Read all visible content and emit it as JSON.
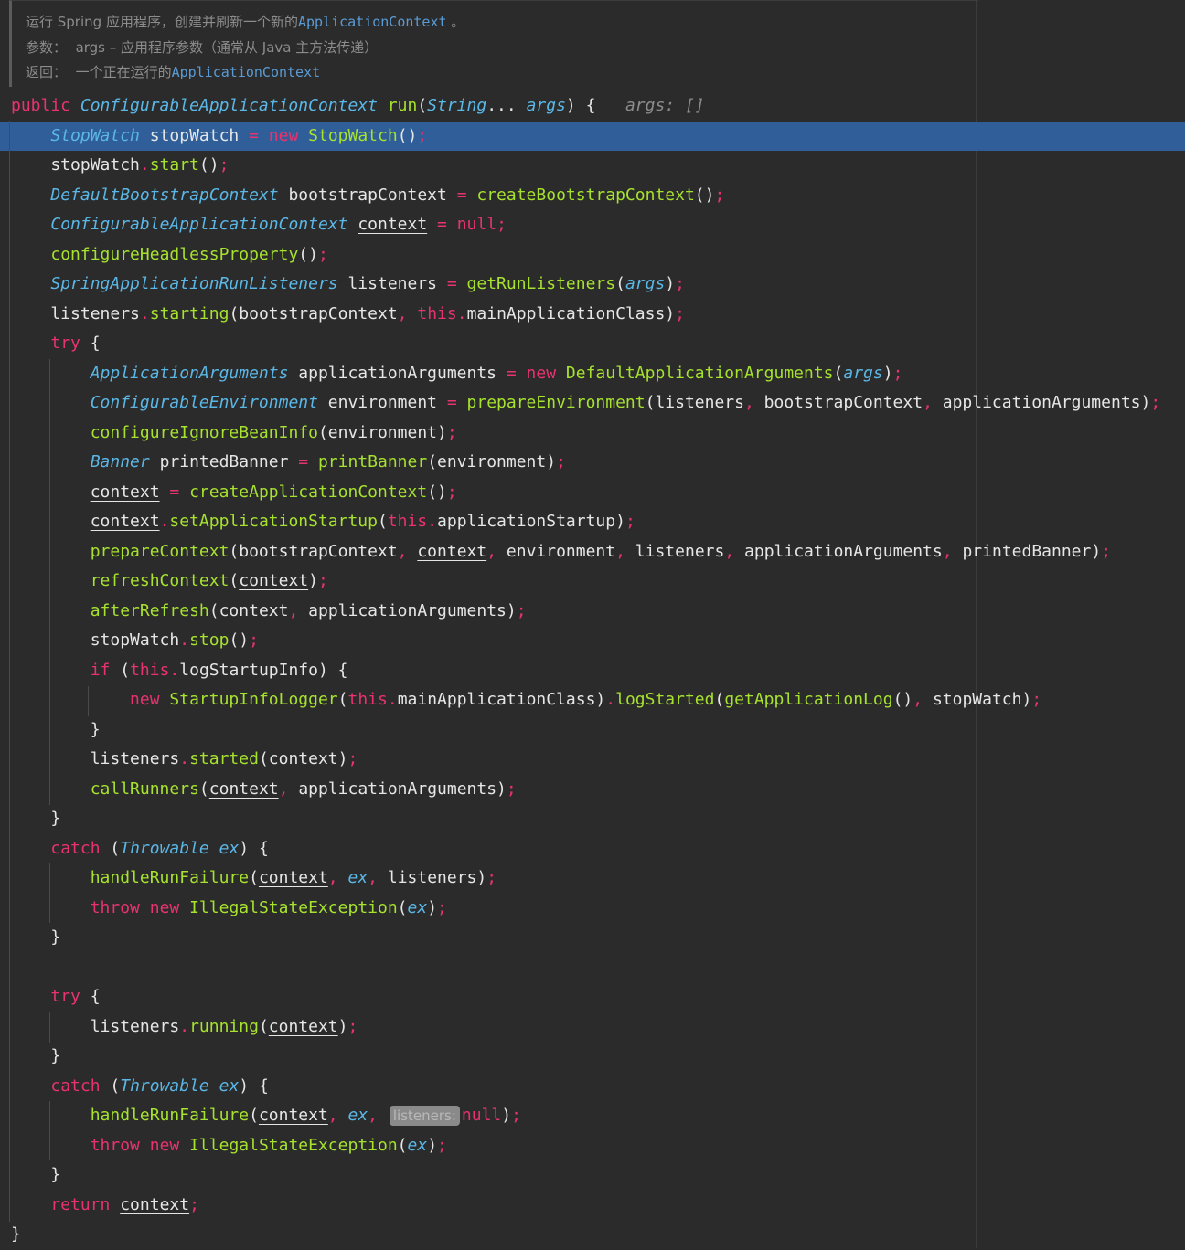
{
  "javadoc": {
    "description_prefix": "运行 Spring 应用程序，创建并刷新一个新的",
    "description_link": "ApplicationContext",
    "description_suffix": " 。",
    "param_label": "参数：",
    "param_text": "args – 应用程序参数（通常从 Java 主方法传递）",
    "returns_label": "返回：",
    "returns_prefix": "一个正在运行的",
    "returns_link": "ApplicationContext"
  },
  "highlighted_line": 1,
  "inlay_hint_label": "listeners:",
  "colors": {
    "background": "#2b2b2b",
    "highlight": "#2f5e99",
    "keyword": "#e8336f",
    "type": "#5ab7e6",
    "method": "#a6e22e",
    "identifier": "#e6e6e6",
    "comment": "#8c8c8c"
  },
  "code_lines": [
    [
      [
        "kw",
        "public "
      ],
      [
        "it",
        "ConfigurableApplicationContext "
      ],
      [
        "fn",
        "run"
      ],
      [
        "pl",
        "("
      ],
      [
        "it",
        "String"
      ],
      [
        "pl",
        "... "
      ],
      [
        "it",
        "args"
      ],
      [
        "pl",
        ") {   "
      ],
      [
        "gr",
        "args: []"
      ]
    ],
    [
      [
        "pl",
        "    "
      ],
      [
        "it",
        "StopWatch "
      ],
      [
        "pl",
        "stopWatch "
      ],
      [
        "pink",
        "= "
      ],
      [
        "kw",
        "new "
      ],
      [
        "fn",
        "StopWatch"
      ],
      [
        "pl",
        "()"
      ],
      [
        "pink",
        ";"
      ]
    ],
    [
      [
        "pl",
        "    stopWatch"
      ],
      [
        "pink",
        "."
      ],
      [
        "fn",
        "start"
      ],
      [
        "pl",
        "()"
      ],
      [
        "pink",
        ";"
      ]
    ],
    [
      [
        "pl",
        "    "
      ],
      [
        "it",
        "DefaultBootstrapContext "
      ],
      [
        "pl",
        "bootstrapContext "
      ],
      [
        "pink",
        "= "
      ],
      [
        "fn",
        "createBootstrapContext"
      ],
      [
        "pl",
        "()"
      ],
      [
        "pink",
        ";"
      ]
    ],
    [
      [
        "pl",
        "    "
      ],
      [
        "it",
        "ConfigurableApplicationContext "
      ],
      [
        "u",
        "context"
      ],
      [
        "pl",
        " "
      ],
      [
        "pink",
        "= "
      ],
      [
        "kw",
        "null"
      ],
      [
        "pink",
        ";"
      ]
    ],
    [
      [
        "pl",
        "    "
      ],
      [
        "fn",
        "configureHeadlessProperty"
      ],
      [
        "pl",
        "()"
      ],
      [
        "pink",
        ";"
      ]
    ],
    [
      [
        "pl",
        "    "
      ],
      [
        "it",
        "SpringApplicationRunListeners "
      ],
      [
        "pl",
        "listeners "
      ],
      [
        "pink",
        "= "
      ],
      [
        "fn",
        "getRunListeners"
      ],
      [
        "pl",
        "("
      ],
      [
        "it",
        "args"
      ],
      [
        "pl",
        ")"
      ],
      [
        "pink",
        ";"
      ]
    ],
    [
      [
        "pl",
        "    listeners"
      ],
      [
        "pink",
        "."
      ],
      [
        "fn",
        "starting"
      ],
      [
        "pl",
        "(bootstrapContext"
      ],
      [
        "pink",
        ", "
      ],
      [
        "kw",
        "this"
      ],
      [
        "pink",
        "."
      ],
      [
        "pl",
        "mainApplicationClass)"
      ],
      [
        "pink",
        ";"
      ]
    ],
    [
      [
        "pl",
        "    "
      ],
      [
        "kw",
        "try "
      ],
      [
        "pl",
        "{"
      ]
    ],
    [
      [
        "pl",
        "        "
      ],
      [
        "it",
        "ApplicationArguments "
      ],
      [
        "pl",
        "applicationArguments "
      ],
      [
        "pink",
        "= "
      ],
      [
        "kw",
        "new "
      ],
      [
        "fn",
        "DefaultApplicationArguments"
      ],
      [
        "pl",
        "("
      ],
      [
        "it",
        "args"
      ],
      [
        "pl",
        ")"
      ],
      [
        "pink",
        ";"
      ]
    ],
    [
      [
        "pl",
        "        "
      ],
      [
        "it",
        "ConfigurableEnvironment "
      ],
      [
        "pl",
        "environment "
      ],
      [
        "pink",
        "= "
      ],
      [
        "fn",
        "prepareEnvironment"
      ],
      [
        "pl",
        "(listeners"
      ],
      [
        "pink",
        ", "
      ],
      [
        "pl",
        "bootstrapContext"
      ],
      [
        "pink",
        ", "
      ],
      [
        "pl",
        "applicationArguments)"
      ],
      [
        "pink",
        ";"
      ]
    ],
    [
      [
        "pl",
        "        "
      ],
      [
        "fn",
        "configureIgnoreBeanInfo"
      ],
      [
        "pl",
        "(environment)"
      ],
      [
        "pink",
        ";"
      ]
    ],
    [
      [
        "pl",
        "        "
      ],
      [
        "it",
        "Banner "
      ],
      [
        "pl",
        "printedBanner "
      ],
      [
        "pink",
        "= "
      ],
      [
        "fn",
        "printBanner"
      ],
      [
        "pl",
        "(environment)"
      ],
      [
        "pink",
        ";"
      ]
    ],
    [
      [
        "pl",
        "        "
      ],
      [
        "u",
        "context"
      ],
      [
        "pl",
        " "
      ],
      [
        "pink",
        "= "
      ],
      [
        "fn",
        "createApplicationContext"
      ],
      [
        "pl",
        "()"
      ],
      [
        "pink",
        ";"
      ]
    ],
    [
      [
        "pl",
        "        "
      ],
      [
        "u",
        "context"
      ],
      [
        "pink",
        "."
      ],
      [
        "fn",
        "setApplicationStartup"
      ],
      [
        "pl",
        "("
      ],
      [
        "kw",
        "this"
      ],
      [
        "pink",
        "."
      ],
      [
        "pl",
        "applicationStartup)"
      ],
      [
        "pink",
        ";"
      ]
    ],
    [
      [
        "pl",
        "        "
      ],
      [
        "fn",
        "prepareContext"
      ],
      [
        "pl",
        "(bootstrapContext"
      ],
      [
        "pink",
        ", "
      ],
      [
        "u",
        "context"
      ],
      [
        "pink",
        ", "
      ],
      [
        "pl",
        "environment"
      ],
      [
        "pink",
        ", "
      ],
      [
        "pl",
        "listeners"
      ],
      [
        "pink",
        ", "
      ],
      [
        "pl",
        "applicationArguments"
      ],
      [
        "pink",
        ", "
      ],
      [
        "pl",
        "printedBanner)"
      ],
      [
        "pink",
        ";"
      ]
    ],
    [
      [
        "pl",
        "        "
      ],
      [
        "fn",
        "refreshContext"
      ],
      [
        "pl",
        "("
      ],
      [
        "u",
        "context"
      ],
      [
        "pl",
        ")"
      ],
      [
        "pink",
        ";"
      ]
    ],
    [
      [
        "pl",
        "        "
      ],
      [
        "fn",
        "afterRefresh"
      ],
      [
        "pl",
        "("
      ],
      [
        "u",
        "context"
      ],
      [
        "pink",
        ", "
      ],
      [
        "pl",
        "applicationArguments)"
      ],
      [
        "pink",
        ";"
      ]
    ],
    [
      [
        "pl",
        "        stopWatch"
      ],
      [
        "pink",
        "."
      ],
      [
        "fn",
        "stop"
      ],
      [
        "pl",
        "()"
      ],
      [
        "pink",
        ";"
      ]
    ],
    [
      [
        "pl",
        "        "
      ],
      [
        "kw",
        "if "
      ],
      [
        "pl",
        "("
      ],
      [
        "kw",
        "this"
      ],
      [
        "pink",
        "."
      ],
      [
        "pl",
        "logStartupInfo) {"
      ]
    ],
    [
      [
        "pl",
        "            "
      ],
      [
        "kw",
        "new "
      ],
      [
        "fn",
        "StartupInfoLogger"
      ],
      [
        "pl",
        "("
      ],
      [
        "kw",
        "this"
      ],
      [
        "pink",
        "."
      ],
      [
        "pl",
        "mainApplicationClass)"
      ],
      [
        "pink",
        "."
      ],
      [
        "fn",
        "logStarted"
      ],
      [
        "pl",
        "("
      ],
      [
        "fn",
        "getApplicationLog"
      ],
      [
        "pl",
        "()"
      ],
      [
        "pink",
        ", "
      ],
      [
        "pl",
        "stopWatch)"
      ],
      [
        "pink",
        ";"
      ]
    ],
    [
      [
        "pl",
        "        }"
      ]
    ],
    [
      [
        "pl",
        "        listeners"
      ],
      [
        "pink",
        "."
      ],
      [
        "fn",
        "started"
      ],
      [
        "pl",
        "("
      ],
      [
        "u",
        "context"
      ],
      [
        "pl",
        ")"
      ],
      [
        "pink",
        ";"
      ]
    ],
    [
      [
        "pl",
        "        "
      ],
      [
        "fn",
        "callRunners"
      ],
      [
        "pl",
        "("
      ],
      [
        "u",
        "context"
      ],
      [
        "pink",
        ", "
      ],
      [
        "pl",
        "applicationArguments)"
      ],
      [
        "pink",
        ";"
      ]
    ],
    [
      [
        "pl",
        "    }"
      ]
    ],
    [
      [
        "pl",
        "    "
      ],
      [
        "kw",
        "catch "
      ],
      [
        "pl",
        "("
      ],
      [
        "it",
        "Throwable "
      ],
      [
        "it",
        "ex"
      ],
      [
        "pl",
        ") {"
      ]
    ],
    [
      [
        "pl",
        "        "
      ],
      [
        "fn",
        "handleRunFailure"
      ],
      [
        "pl",
        "("
      ],
      [
        "u",
        "context"
      ],
      [
        "pink",
        ", "
      ],
      [
        "it",
        "ex"
      ],
      [
        "pink",
        ", "
      ],
      [
        "pl",
        "listeners)"
      ],
      [
        "pink",
        ";"
      ]
    ],
    [
      [
        "pl",
        "        "
      ],
      [
        "kw",
        "throw "
      ],
      [
        "kw",
        "new "
      ],
      [
        "fn",
        "IllegalStateException"
      ],
      [
        "pl",
        "("
      ],
      [
        "it",
        "ex"
      ],
      [
        "pl",
        ")"
      ],
      [
        "pink",
        ";"
      ]
    ],
    [
      [
        "pl",
        "    }"
      ]
    ],
    [
      [
        "pl",
        ""
      ]
    ],
    [
      [
        "pl",
        "    "
      ],
      [
        "kw",
        "try "
      ],
      [
        "pl",
        "{"
      ]
    ],
    [
      [
        "pl",
        "        listeners"
      ],
      [
        "pink",
        "."
      ],
      [
        "fn",
        "running"
      ],
      [
        "pl",
        "("
      ],
      [
        "u",
        "context"
      ],
      [
        "pl",
        ")"
      ],
      [
        "pink",
        ";"
      ]
    ],
    [
      [
        "pl",
        "    }"
      ]
    ],
    [
      [
        "pl",
        "    "
      ],
      [
        "kw",
        "catch "
      ],
      [
        "pl",
        "("
      ],
      [
        "it",
        "Throwable "
      ],
      [
        "it",
        "ex"
      ],
      [
        "pl",
        ") {"
      ]
    ],
    [
      [
        "pl",
        "        "
      ],
      [
        "fn",
        "handleRunFailure"
      ],
      [
        "pl",
        "("
      ],
      [
        "u",
        "context"
      ],
      [
        "pink",
        ", "
      ],
      [
        "it",
        "ex"
      ],
      [
        "pink",
        ", "
      ],
      [
        "hint",
        "listeners:"
      ],
      [
        "kw",
        "null"
      ],
      [
        "pl",
        ")"
      ],
      [
        "pink",
        ";"
      ]
    ],
    [
      [
        "pl",
        "        "
      ],
      [
        "kw",
        "throw "
      ],
      [
        "kw",
        "new "
      ],
      [
        "fn",
        "IllegalStateException"
      ],
      [
        "pl",
        "("
      ],
      [
        "it",
        "ex"
      ],
      [
        "pl",
        ")"
      ],
      [
        "pink",
        ";"
      ]
    ],
    [
      [
        "pl",
        "    }"
      ]
    ],
    [
      [
        "pl",
        "    "
      ],
      [
        "kw",
        "return "
      ],
      [
        "u",
        "context"
      ],
      [
        "pink",
        ";"
      ]
    ],
    [
      [
        "pl",
        "}"
      ]
    ]
  ]
}
